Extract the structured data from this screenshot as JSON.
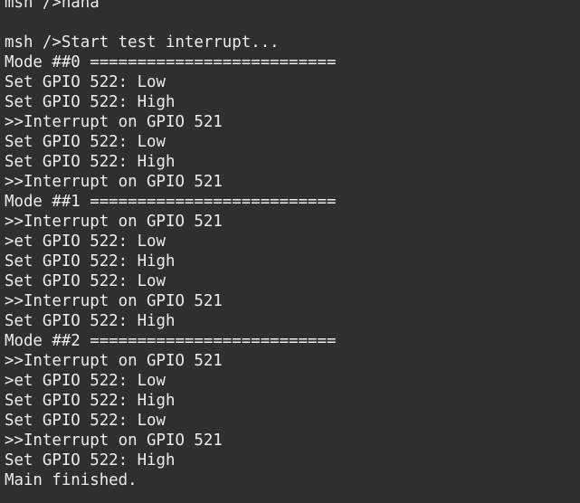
{
  "terminal": {
    "lines": [
      "msh />hana",
      "",
      "msh />Start test interrupt...",
      "Mode ##0 ==========================",
      "Set GPIO 522: Low",
      "Set GPIO 522: High",
      ">>Interrupt on GPIO 521",
      "Set GPIO 522: Low",
      "Set GPIO 522: High",
      ">>Interrupt on GPIO 521",
      "Mode ##1 ==========================",
      ">>Interrupt on GPIO 521",
      ">et GPIO 522: Low",
      "Set GPIO 522: High",
      "Set GPIO 522: Low",
      ">>Interrupt on GPIO 521",
      "Set GPIO 522: High",
      "Mode ##2 ==========================",
      ">>Interrupt on GPIO 521",
      ">et GPIO 522: Low",
      "Set GPIO 522: High",
      "Set GPIO 522: Low",
      ">>Interrupt on GPIO 521",
      "Set GPIO 522: High",
      "Main finished."
    ]
  },
  "colors": {
    "background": "#2f2f2f",
    "text": "#ededed"
  }
}
